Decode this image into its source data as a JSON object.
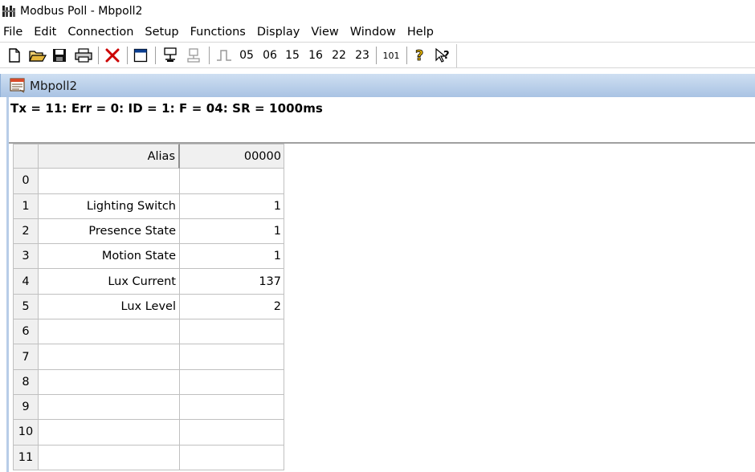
{
  "window": {
    "title": "Modbus Poll - Mbpoll2"
  },
  "menu": [
    {
      "label": "File"
    },
    {
      "label": "Edit"
    },
    {
      "label": "Connection"
    },
    {
      "label": "Setup"
    },
    {
      "label": "Functions"
    },
    {
      "label": "Display"
    },
    {
      "label": "View"
    },
    {
      "label": "Window"
    },
    {
      "label": "Help"
    }
  ],
  "toolbar": {
    "icons": [
      "new-document-icon",
      "open-folder-icon",
      "save-disk-icon",
      "print-icon",
      "delete-x-icon",
      "window-icon",
      "connect-icon",
      "disconnect-icon",
      "pulse-icon",
      "help-icon",
      "context-help-icon"
    ],
    "fc05": "05",
    "fc06": "06",
    "fc15": "15",
    "fc16": "16",
    "fc22": "22",
    "fc23": "23",
    "fc101": "101",
    "delete_color": "#cc0000"
  },
  "child_window": {
    "title": "Mbpoll2",
    "status": "Tx = 11: Err = 0: ID = 1: F = 04: SR = 1000ms",
    "caption_color": "#b9d1ee"
  },
  "grid": {
    "header": {
      "alias": "Alias",
      "value": "00000"
    },
    "rows": [
      {
        "index": "0",
        "alias": "",
        "value": ""
      },
      {
        "index": "1",
        "alias": "Lighting Switch",
        "value": "1"
      },
      {
        "index": "2",
        "alias": "Presence State",
        "value": "1"
      },
      {
        "index": "3",
        "alias": "Motion State",
        "value": "1"
      },
      {
        "index": "4",
        "alias": "Lux Current",
        "value": "137"
      },
      {
        "index": "5",
        "alias": "Lux Level",
        "value": "2"
      },
      {
        "index": "6",
        "alias": "",
        "value": ""
      },
      {
        "index": "7",
        "alias": "",
        "value": ""
      },
      {
        "index": "8",
        "alias": "",
        "value": ""
      },
      {
        "index": "9",
        "alias": "",
        "value": ""
      },
      {
        "index": "10",
        "alias": "",
        "value": ""
      },
      {
        "index": "11",
        "alias": "",
        "value": ""
      }
    ]
  }
}
